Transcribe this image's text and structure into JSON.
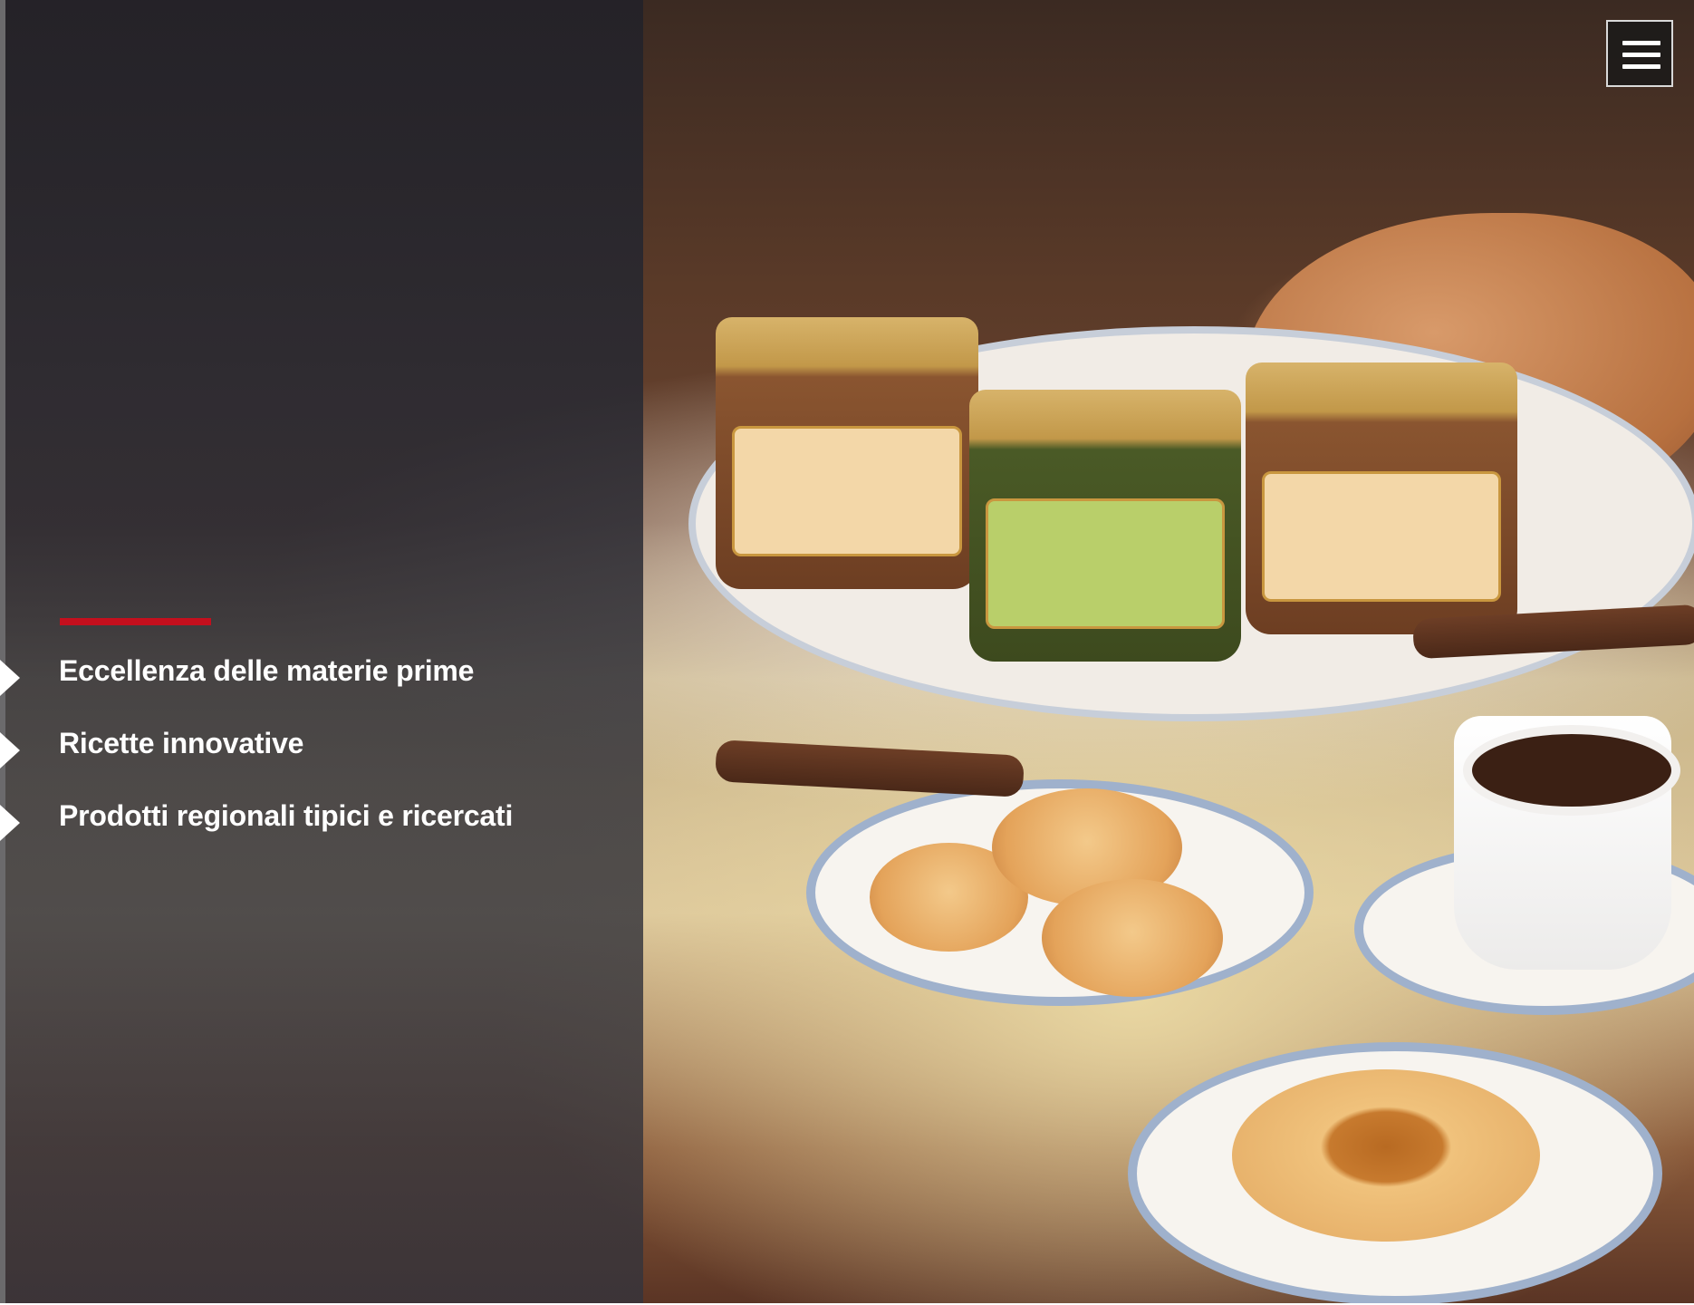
{
  "header": {
    "menu_button": {
      "icon": "hamburger-menu-icon"
    }
  },
  "hero": {
    "features": [
      {
        "label": "Eccellenza delle materie prime",
        "icon": "triangle-bullet-icon"
      },
      {
        "label": "Ricette innovative",
        "icon": "triangle-bullet-icon"
      },
      {
        "label": "Prodotti regionali tipici e ricercati",
        "icon": "triangle-bullet-icon"
      }
    ],
    "accent_color": "#c40f1d",
    "overlay_color": "#2e2e36"
  }
}
